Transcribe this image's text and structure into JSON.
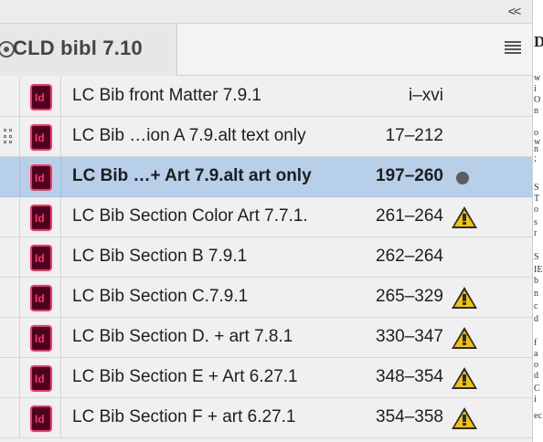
{
  "panel": {
    "collapse_label": "<<",
    "tab_title": "CLD bibl 7.10",
    "menu_icon": "hamburger-menu-icon"
  },
  "documents": [
    {
      "name": "LC Bib front Matter 7.9.1",
      "pages": "i–xvi",
      "status": "",
      "selected": false,
      "has_gutter_icon": false
    },
    {
      "name": "LC Bib …ion A  7.9.alt text only",
      "pages": "17–212",
      "status": "",
      "selected": false,
      "has_gutter_icon": true
    },
    {
      "name": "LC Bib …+ Art 7.9.alt art only",
      "pages": "197–260",
      "status": "open",
      "selected": true,
      "has_gutter_icon": false
    },
    {
      "name": "LC Bib Section Color Art 7.7.1.",
      "pages": "261–264",
      "status": "warning",
      "selected": false,
      "has_gutter_icon": false
    },
    {
      "name": "LC Bib Section B 7.9.1",
      "pages": "262–264",
      "status": "",
      "selected": false,
      "has_gutter_icon": false
    },
    {
      "name": "LC Bib Section C.7.9.1",
      "pages": "265–329",
      "status": "warning",
      "selected": false,
      "has_gutter_icon": false
    },
    {
      "name": "LC Bib Section D. + art 7.8.1",
      "pages": "330–347",
      "status": "warning",
      "selected": false,
      "has_gutter_icon": false
    },
    {
      "name": "LC Bib Section E + Art 6.27.1",
      "pages": "348–354",
      "status": "warning",
      "selected": false,
      "has_gutter_icon": false
    },
    {
      "name": "LC Bib Section F + art 6.27.1",
      "pages": "354–358",
      "status": "warning",
      "selected": false,
      "has_gutter_icon": false
    }
  ],
  "colors": {
    "selection": "#b7cfe9",
    "indesign_icon_bg": "#49021f",
    "indesign_icon_fg": "#ff3366",
    "warning": "#f5c400"
  },
  "background_document": {
    "cap": "D",
    "fragments": [
      "w",
      "i",
      "O",
      "n",
      "o",
      "w",
      "n",
      ";",
      "S",
      "T",
      "o",
      "s",
      "r",
      "S",
      "IE",
      "b",
      "n",
      "c",
      "d",
      "f",
      "a",
      "o",
      "d",
      "C",
      "i",
      "ec"
    ]
  }
}
